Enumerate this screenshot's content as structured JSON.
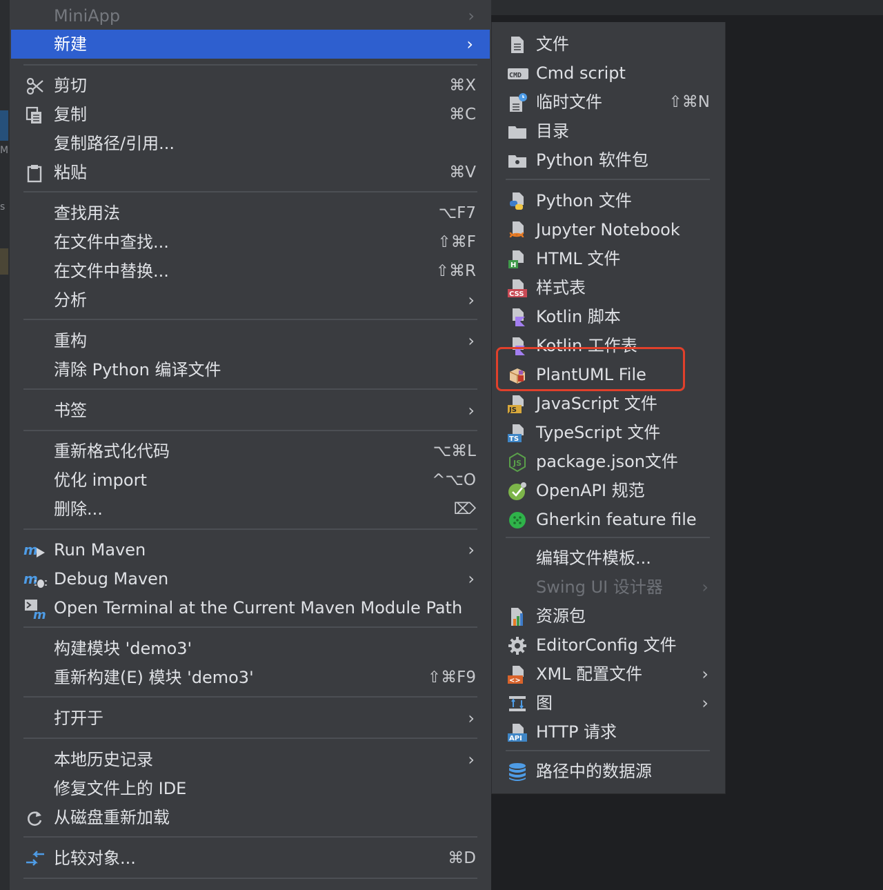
{
  "menu": {
    "items": [
      {
        "name": "miniapp-item",
        "label": "MiniApp",
        "arrow": "›",
        "disabled": true
      },
      {
        "name": "new-item",
        "label": "新建",
        "arrow": "›",
        "active": true
      },
      {
        "name": "cut-item",
        "label": "剪切",
        "shortcut": "⌘X",
        "icon": "scissors-icon"
      },
      {
        "name": "copy-item",
        "label": "复制",
        "shortcut": "⌘C",
        "icon": "copy-icon"
      },
      {
        "name": "copy-path-item",
        "label": "复制路径/引用..."
      },
      {
        "name": "paste-item",
        "label": "粘贴",
        "shortcut": "⌘V",
        "icon": "clipboard-icon"
      },
      {
        "name": "find-usages-item",
        "label": "查找用法",
        "shortcut": "⌥F7"
      },
      {
        "name": "find-in-files-item",
        "label": "在文件中查找...",
        "shortcut": "⇧⌘F"
      },
      {
        "name": "replace-in-files-item",
        "label": "在文件中替换...",
        "shortcut": "⇧⌘R"
      },
      {
        "name": "analyze-item",
        "label": "分析",
        "arrow": "›"
      },
      {
        "name": "refactor-item",
        "label": "重构",
        "arrow": "›"
      },
      {
        "name": "clean-python-item",
        "label": "清除 Python 编译文件"
      },
      {
        "name": "bookmarks-item",
        "label": "书签",
        "arrow": "›"
      },
      {
        "name": "reformat-code-item",
        "label": "重新格式化代码",
        "shortcut": "⌥⌘L"
      },
      {
        "name": "optimize-imports-item",
        "label": "优化 import",
        "shortcut": "^⌥O"
      },
      {
        "name": "delete-item",
        "label": "删除...",
        "shortcut": "⌦"
      },
      {
        "name": "run-maven-item",
        "label": "Run Maven",
        "arrow": "›",
        "icon": "maven-run-icon"
      },
      {
        "name": "debug-maven-item",
        "label": "Debug Maven",
        "arrow": "›",
        "icon": "maven-debug-icon"
      },
      {
        "name": "open-terminal-item",
        "label": "Open Terminal at the Current Maven Module Path",
        "icon": "terminal-maven-icon"
      },
      {
        "name": "build-module-item",
        "label": "构建模块 'demo3'"
      },
      {
        "name": "rebuild-module-item",
        "label": "重新构建(E) 模块 'demo3'",
        "shortcut": "⇧⌘F9"
      },
      {
        "name": "open-in-item",
        "label": "打开于",
        "arrow": "›"
      },
      {
        "name": "local-history-item",
        "label": "本地历史记录",
        "arrow": "›"
      },
      {
        "name": "repair-ide-item",
        "label": "修复文件上的 IDE"
      },
      {
        "name": "reload-from-disk-item",
        "label": "从磁盘重新加载",
        "icon": "reload-icon"
      },
      {
        "name": "compare-with-item",
        "label": "比较对象...",
        "shortcut": "⌘D",
        "icon": "compare-icon"
      }
    ]
  },
  "submenu": {
    "items": [
      {
        "name": "file-item",
        "label": "文件",
        "icon": "file-icon"
      },
      {
        "name": "cmd-script-item",
        "label": "Cmd script",
        "icon": "cmd-icon"
      },
      {
        "name": "scratch-file-item",
        "label": "临时文件",
        "shortcut": "⇧⌘N",
        "icon": "scratch-file-icon"
      },
      {
        "name": "directory-item",
        "label": "目录",
        "icon": "folder-icon"
      },
      {
        "name": "python-package-item",
        "label": "Python 软件包",
        "icon": "package-folder-icon"
      },
      {
        "name": "python-file-item",
        "label": "Python 文件",
        "icon": "python-file-icon"
      },
      {
        "name": "jupyter-notebook-item",
        "label": "Jupyter Notebook",
        "icon": "jupyter-icon"
      },
      {
        "name": "html-file-item",
        "label": "HTML 文件",
        "icon": "html-file-icon"
      },
      {
        "name": "stylesheet-item",
        "label": "样式表",
        "icon": "css-file-icon"
      },
      {
        "name": "kotlin-script-item",
        "label": "Kotlin 脚本",
        "icon": "kotlin-script-icon"
      },
      {
        "name": "kotlin-worksheet-item",
        "label": "Kotlin 工作表",
        "icon": "kotlin-worksheet-icon"
      },
      {
        "name": "plantuml-file-item",
        "label": "PlantUML File",
        "icon": "plantuml-icon"
      },
      {
        "name": "javascript-file-item",
        "label": "JavaScript 文件",
        "icon": "js-file-icon"
      },
      {
        "name": "typescript-file-item",
        "label": "TypeScript 文件",
        "icon": "ts-file-icon"
      },
      {
        "name": "package-json-item",
        "label": "package.json文件",
        "icon": "nodejs-icon"
      },
      {
        "name": "openapi-item",
        "label": "OpenAPI 规范",
        "icon": "openapi-icon"
      },
      {
        "name": "gherkin-item",
        "label": "Gherkin feature file",
        "icon": "cucumber-icon"
      },
      {
        "name": "edit-templates-item",
        "label": "编辑文件模板..."
      },
      {
        "name": "swing-designer-item",
        "label": "Swing UI 设计器",
        "arrow": "›",
        "disabled": true
      },
      {
        "name": "resource-bundle-item",
        "label": "资源包",
        "icon": "resource-bundle-icon"
      },
      {
        "name": "editorconfig-item",
        "label": "EditorConfig 文件",
        "icon": "gear-icon"
      },
      {
        "name": "xml-config-item",
        "label": "XML 配置文件",
        "arrow": "›",
        "icon": "xml-file-icon"
      },
      {
        "name": "diagram-item",
        "label": "图",
        "arrow": "›",
        "icon": "diagram-icon"
      },
      {
        "name": "http-request-item",
        "label": "HTTP 请求",
        "icon": "api-file-icon"
      },
      {
        "name": "datasource-in-path-item",
        "label": "路径中的数据源",
        "icon": "database-icon"
      }
    ]
  },
  "colors": {
    "active": "#2e5fcf",
    "menu_bg": "#3a3c40",
    "highlight": "#e0402b"
  }
}
